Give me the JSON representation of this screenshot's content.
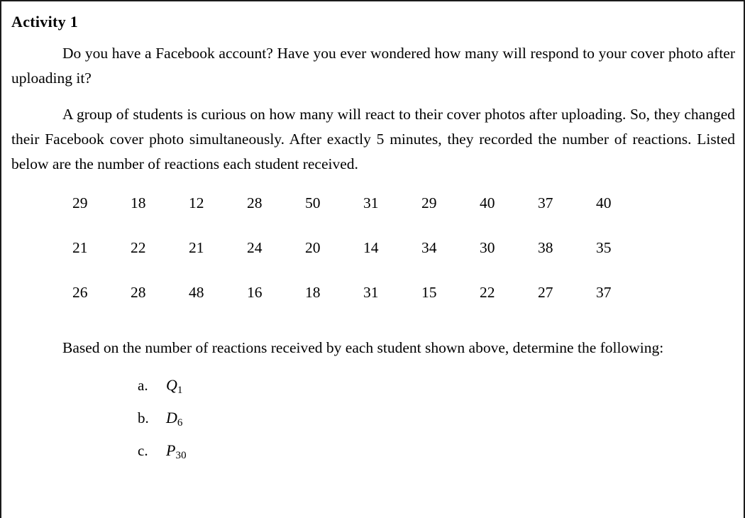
{
  "document": {
    "heading": "Activity 1",
    "paragraphs": [
      "Do you have a Facebook account? Have you ever wondered how many will respond to your cover photo after uploading it?",
      "A group of students is curious on how many will react to their cover photos after uploading. So, they changed their Facebook cover photo simultaneously. After exactly 5 minutes, they recorded the number of reactions. Listed below are the number of reactions each student received."
    ],
    "closing_paragraph": "Based on the number of reactions received by each student shown above, determine the following:",
    "data_label": "number of reactions each student received",
    "data_rows": [
      [
        "29",
        "18",
        "12",
        "28",
        "50",
        "31",
        "29",
        "40",
        "37",
        "40"
      ],
      [
        "21",
        "22",
        "21",
        "24",
        "20",
        "14",
        "34",
        "30",
        "38",
        "35"
      ],
      [
        "26",
        "28",
        "48",
        "16",
        "18",
        "31",
        "15",
        "22",
        "27",
        "37"
      ]
    ],
    "questions": [
      {
        "letter": "a.",
        "symbol": "Q",
        "subscript": "1"
      },
      {
        "letter": "b.",
        "symbol": "D",
        "subscript": "6"
      },
      {
        "letter": "c.",
        "symbol": "P",
        "subscript": "30"
      }
    ]
  },
  "colors": {
    "text": "#000000",
    "border": "#1a1a1a",
    "background": "#ffffff"
  }
}
